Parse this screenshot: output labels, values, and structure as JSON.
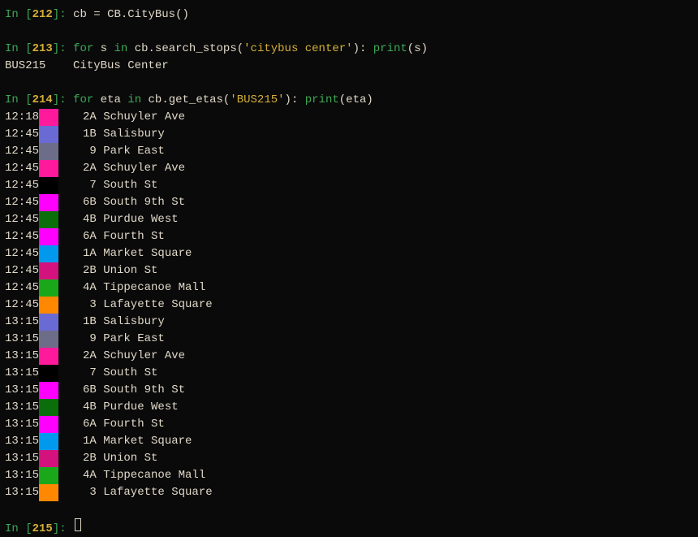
{
  "cells": [
    {
      "num": "212",
      "code_parts": [
        {
          "text": "cb = CB.CityBus()",
          "cls": "cmd"
        }
      ],
      "output": null
    },
    {
      "num": "213",
      "code_parts": [
        {
          "text": "for",
          "cls": "keyword"
        },
        {
          "text": " s ",
          "cls": "cmd"
        },
        {
          "text": "in",
          "cls": "keyword"
        },
        {
          "text": " cb.search_stops(",
          "cls": "cmd"
        },
        {
          "text": "'citybus center'",
          "cls": "string"
        },
        {
          "text": "): ",
          "cls": "cmd"
        },
        {
          "text": "print",
          "cls": "func"
        },
        {
          "text": "(s)",
          "cls": "cmd"
        }
      ],
      "output": "BUS215    CityBus Center"
    },
    {
      "num": "214",
      "code_parts": [
        {
          "text": "for",
          "cls": "keyword"
        },
        {
          "text": " eta ",
          "cls": "cmd"
        },
        {
          "text": "in",
          "cls": "keyword"
        },
        {
          "text": " cb.get_etas(",
          "cls": "cmd"
        },
        {
          "text": "'BUS215'",
          "cls": "string"
        },
        {
          "text": "): ",
          "cls": "cmd"
        },
        {
          "text": "print",
          "cls": "func"
        },
        {
          "text": "(eta)",
          "cls": "cmd"
        }
      ],
      "output": null
    }
  ],
  "etas": [
    {
      "time": "12:18",
      "color": "#ff1a9c",
      "route": "2A",
      "name": "Schuyler Ave"
    },
    {
      "time": "12:45",
      "color": "#6a6ad4",
      "route": "1B",
      "name": "Salisbury"
    },
    {
      "time": "12:45",
      "color": "#6d6d8a",
      "route": " 9",
      "name": "Park East"
    },
    {
      "time": "12:45",
      "color": "#ff1a9c",
      "route": "2A",
      "name": "Schuyler Ave"
    },
    {
      "time": "12:45",
      "color": "#000000",
      "route": " 7",
      "name": "South St"
    },
    {
      "time": "12:45",
      "color": "#ff00ff",
      "route": "6B",
      "name": "South 9th St"
    },
    {
      "time": "12:45",
      "color": "#0a6e0a",
      "route": "4B",
      "name": "Purdue West"
    },
    {
      "time": "12:45",
      "color": "#ff00ff",
      "route": "6A",
      "name": "Fourth St"
    },
    {
      "time": "12:45",
      "color": "#0099ee",
      "route": "1A",
      "name": "Market Square"
    },
    {
      "time": "12:45",
      "color": "#d4127e",
      "route": "2B",
      "name": "Union St"
    },
    {
      "time": "12:45",
      "color": "#1aa81a",
      "route": "4A",
      "name": "Tippecanoe Mall"
    },
    {
      "time": "12:45",
      "color": "#ff8800",
      "route": " 3",
      "name": "Lafayette Square"
    },
    {
      "time": "13:15",
      "color": "#6a6ad4",
      "route": "1B",
      "name": "Salisbury"
    },
    {
      "time": "13:15",
      "color": "#6d6d8a",
      "route": " 9",
      "name": "Park East"
    },
    {
      "time": "13:15",
      "color": "#ff1a9c",
      "route": "2A",
      "name": "Schuyler Ave"
    },
    {
      "time": "13:15",
      "color": "#000000",
      "route": " 7",
      "name": "South St"
    },
    {
      "time": "13:15",
      "color": "#ff00ff",
      "route": "6B",
      "name": "South 9th St"
    },
    {
      "time": "13:15",
      "color": "#0a6e0a",
      "route": "4B",
      "name": "Purdue West"
    },
    {
      "time": "13:15",
      "color": "#ff00ff",
      "route": "6A",
      "name": "Fourth St"
    },
    {
      "time": "13:15",
      "color": "#0099ee",
      "route": "1A",
      "name": "Market Square"
    },
    {
      "time": "13:15",
      "color": "#d4127e",
      "route": "2B",
      "name": "Union St"
    },
    {
      "time": "13:15",
      "color": "#1aa81a",
      "route": "4A",
      "name": "Tippecanoe Mall"
    },
    {
      "time": "13:15",
      "color": "#ff8800",
      "route": " 3",
      "name": "Lafayette Square"
    }
  ],
  "next_prompt": "215",
  "prompt_labels": {
    "in": "In ",
    "open": "[",
    "close": "]:",
    "sep": " "
  }
}
